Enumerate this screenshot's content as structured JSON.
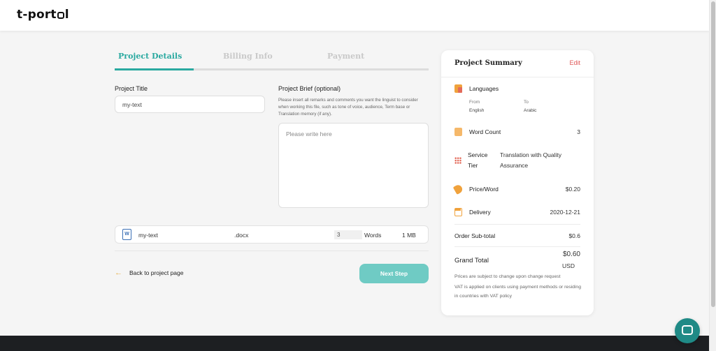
{
  "app": {
    "logo_left": "t-port",
    "logo_right": "l"
  },
  "tabs": [
    {
      "label": "Project Details",
      "active": true
    },
    {
      "label": "Billing Info",
      "active": false
    },
    {
      "label": "Payment",
      "active": false
    }
  ],
  "form": {
    "title_label": "Project Title",
    "title_value": "my-text",
    "brief_label": "Project Brief (optional)",
    "brief_help": "Please insert all remarks and comments you want the linguist to consider when working this file, such as tone of voice, audience, Term base or Translation memory (if any).",
    "brief_placeholder": "Please write here"
  },
  "file": {
    "icon": "word-doc-icon",
    "name": "my-text",
    "ext": ".docx",
    "word_count": "3",
    "words_label": "Words",
    "size": "1 MB"
  },
  "nav": {
    "back_label": "Back to project page",
    "next_label": "Next Step"
  },
  "summary": {
    "title": "Project Summary",
    "edit_label": "Edit",
    "languages_label": "Languages",
    "from_label": "From",
    "from_value": "English",
    "to_label": "To",
    "to_value": "Arabic",
    "word_count_label": "Word Count",
    "word_count_value": "3",
    "service_label_1": "Service",
    "service_label_2": "Tier",
    "service_value_1": "Translation with Quality",
    "service_value_2": "Assurance",
    "price_label": "Price/Word",
    "price_value": "$0.20",
    "delivery_label": "Delivery",
    "delivery_value": "2020-12-21",
    "subtotal_label": "Order Sub-total",
    "subtotal_value": "$0.6",
    "grand_label": "Grand Total",
    "grand_value": "$0.60",
    "grand_currency": "USD",
    "note_1": "Prices are subject to change upon change request",
    "note_2": "VAT is applied on clients using payment methods or residing in countries with VAT policy"
  },
  "colors": {
    "accent": "#2aa9a0",
    "button": "#6fcbc4",
    "edit": "#e05a5a",
    "icon_orange": "#f0a23c"
  }
}
